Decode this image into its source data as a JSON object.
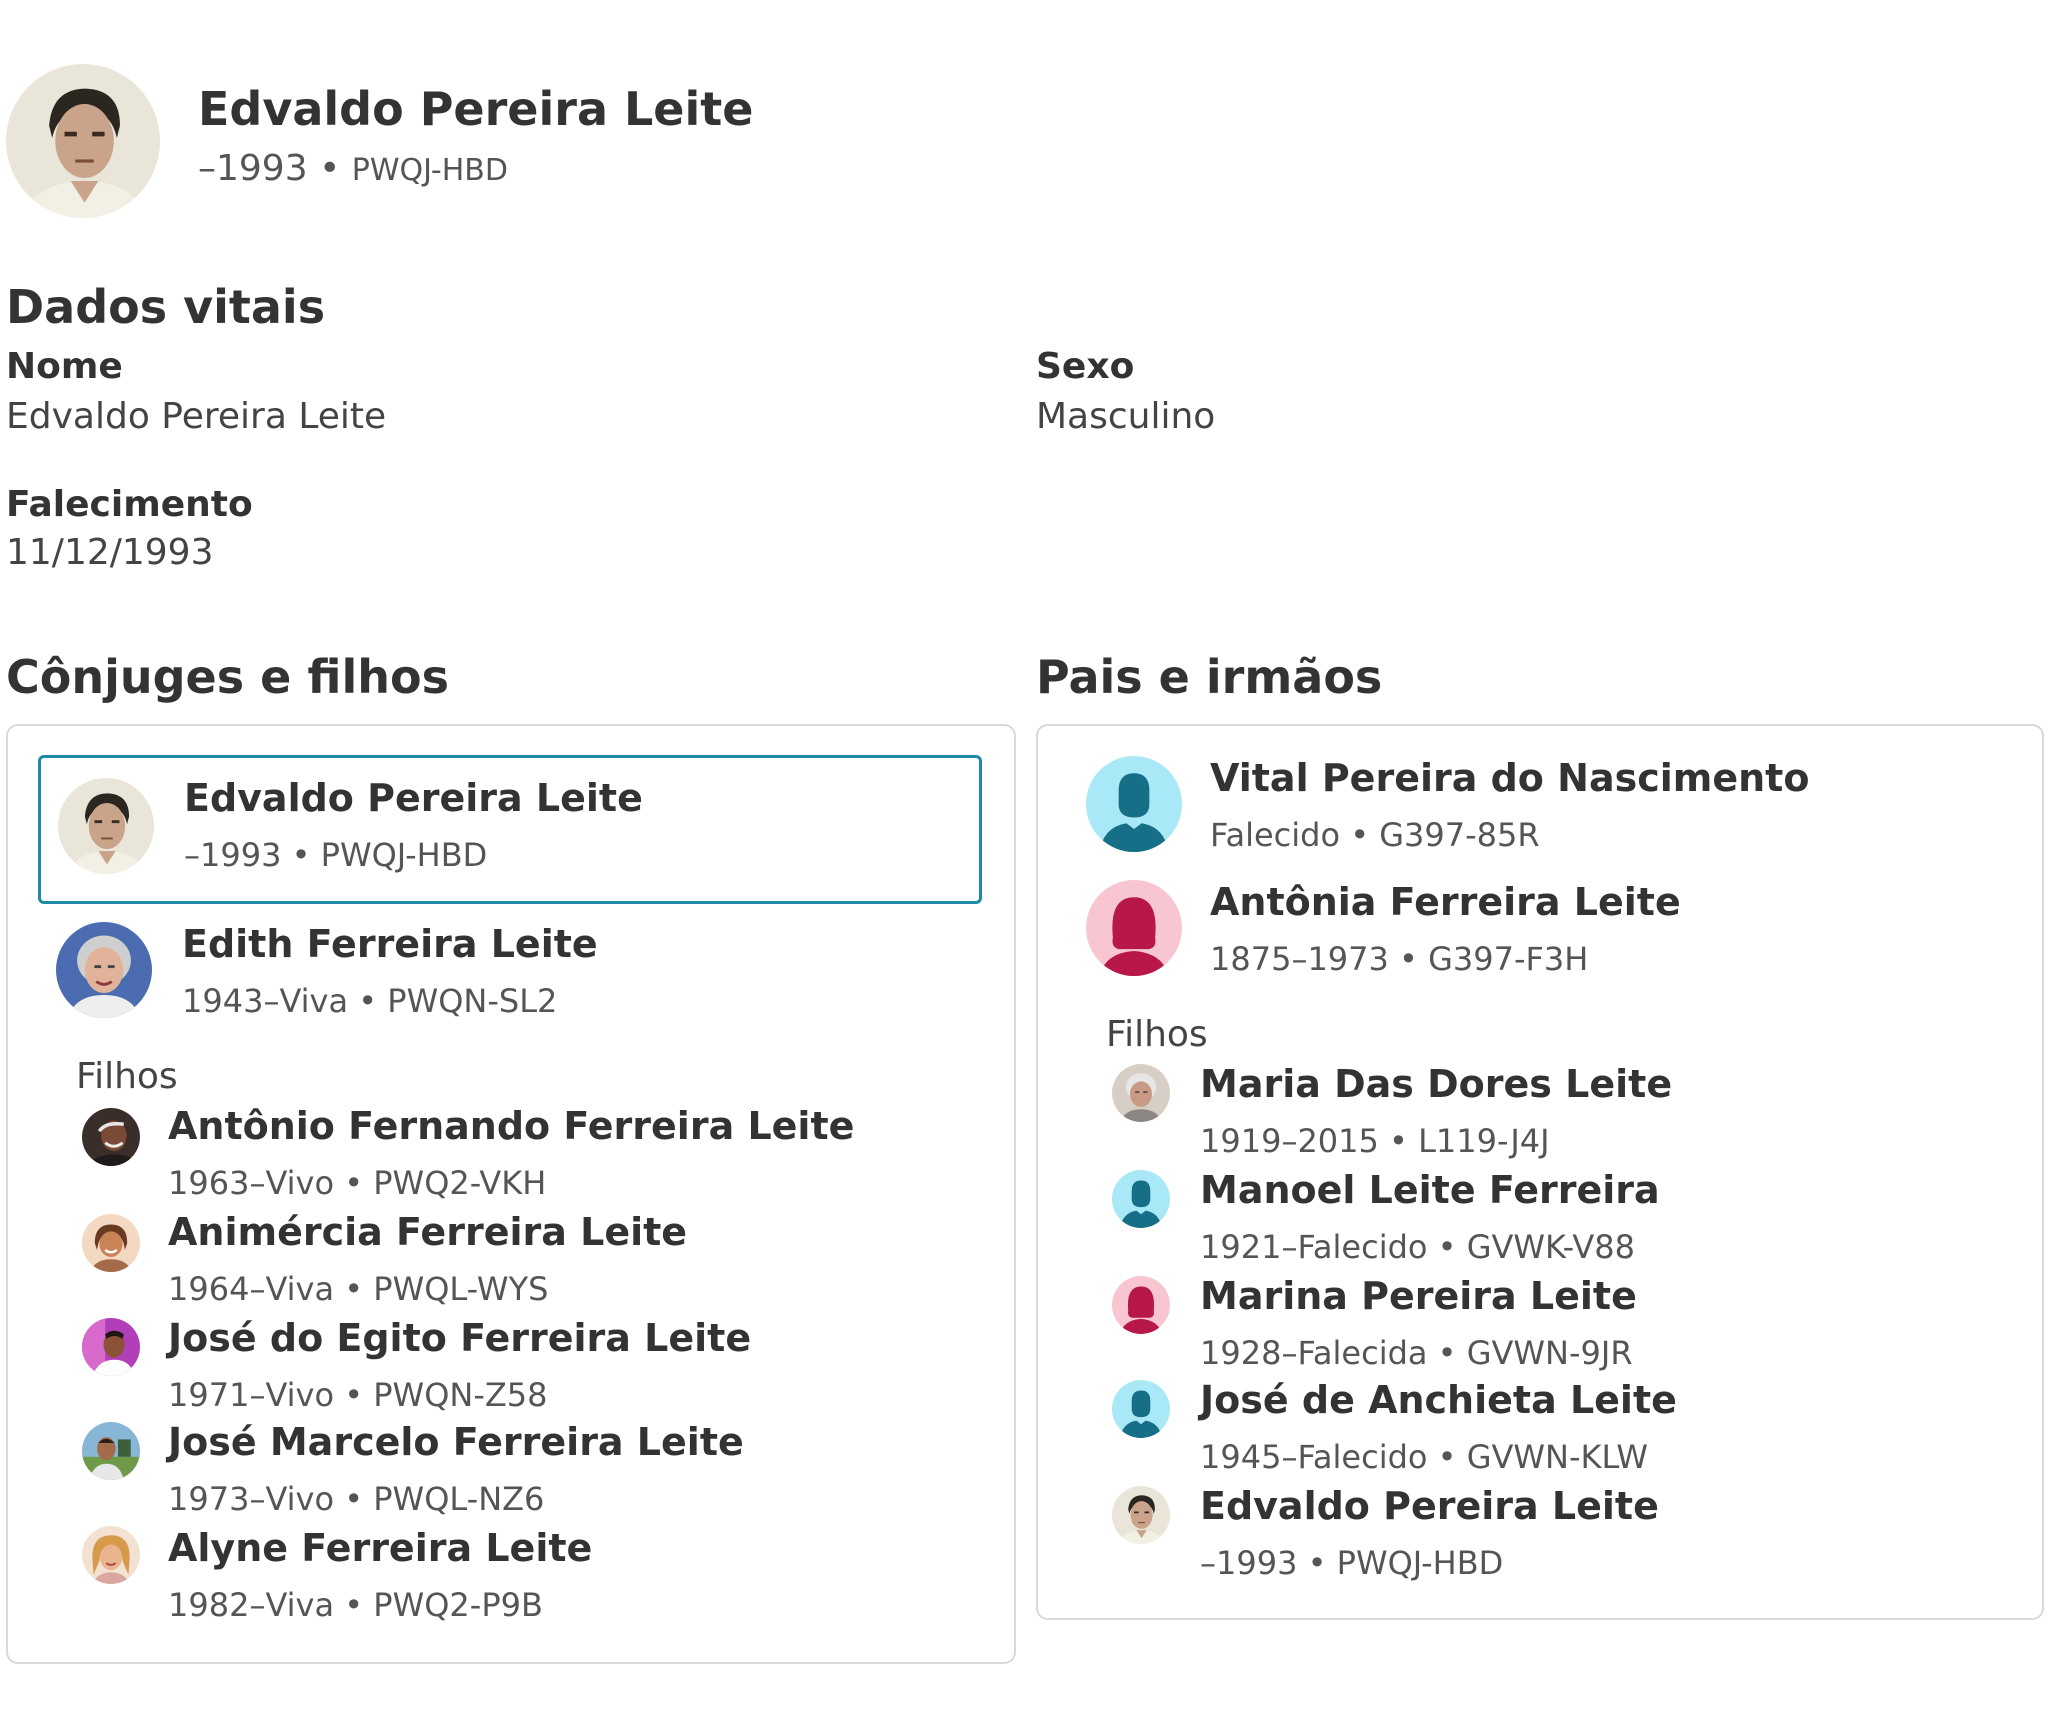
{
  "header": {
    "name": "Edvaldo Pereira Leite",
    "lifespan": "–1993",
    "separator": "•",
    "pid": "PWQJ-HBD"
  },
  "vital": {
    "title": "Dados vitais",
    "name_label": "Nome",
    "name_value": "Edvaldo Pereira Leite",
    "sex_label": "Sexo",
    "sex_value": "Masculino",
    "death_label": "Falecimento",
    "death_value": "11/12/1993"
  },
  "spouses": {
    "title": "Cônjuges e filhos",
    "selected": {
      "name": "Edvaldo Pereira Leite",
      "meta": "–1993 • PWQJ-HBD"
    },
    "spouse": {
      "name": "Edith Ferreira Leite",
      "meta": "1943–Viva • PWQN-SL2"
    },
    "children_label": "Filhos",
    "children": [
      {
        "name": "Antônio Fernando Ferreira Leite",
        "meta": "1963–Vivo • PWQ2-VKH"
      },
      {
        "name": "Animércia Ferreira Leite",
        "meta": "1964–Viva • PWQL-WYS"
      },
      {
        "name": "José do Egito Ferreira Leite",
        "meta": "1971–Vivo • PWQN-Z58"
      },
      {
        "name": "José Marcelo Ferreira Leite",
        "meta": "1973–Vivo • PWQL-NZ6"
      },
      {
        "name": "Alyne Ferreira Leite",
        "meta": "1982–Viva • PWQ2-P9B"
      }
    ]
  },
  "parents": {
    "title": "Pais e irmãos",
    "father": {
      "name": "Vital Pereira do Nascimento",
      "meta": "Falecido • G397-85R"
    },
    "mother": {
      "name": "Antônia Ferreira Leite",
      "meta": "1875–1973 • G397-F3H"
    },
    "children_label": "Filhos",
    "children": [
      {
        "name": "Maria Das Dores Leite",
        "meta": "1919–2015 • L119-J4J"
      },
      {
        "name": "Manoel Leite Ferreira",
        "meta": "1921–Falecido • GVWK-V88"
      },
      {
        "name": "Marina Pereira Leite",
        "meta": "1928–Falecida • GVWN-9JR"
      },
      {
        "name": "José de Anchieta Leite",
        "meta": "1945–Falecido • GVWN-KLW"
      },
      {
        "name": "Edvaldo Pereira Leite",
        "meta": "–1993 • PWQJ-HBD"
      }
    ]
  },
  "colors": {
    "selected_border": "#1f8aa8",
    "male_placeholder_bg": "#a8e8f7",
    "male_placeholder_fg": "#176e87",
    "female_placeholder_bg": "#f7c6d1",
    "female_placeholder_fg": "#b8174a"
  },
  "icons": {
    "male": "male-silhouette-icon",
    "female": "female-silhouette-icon"
  }
}
